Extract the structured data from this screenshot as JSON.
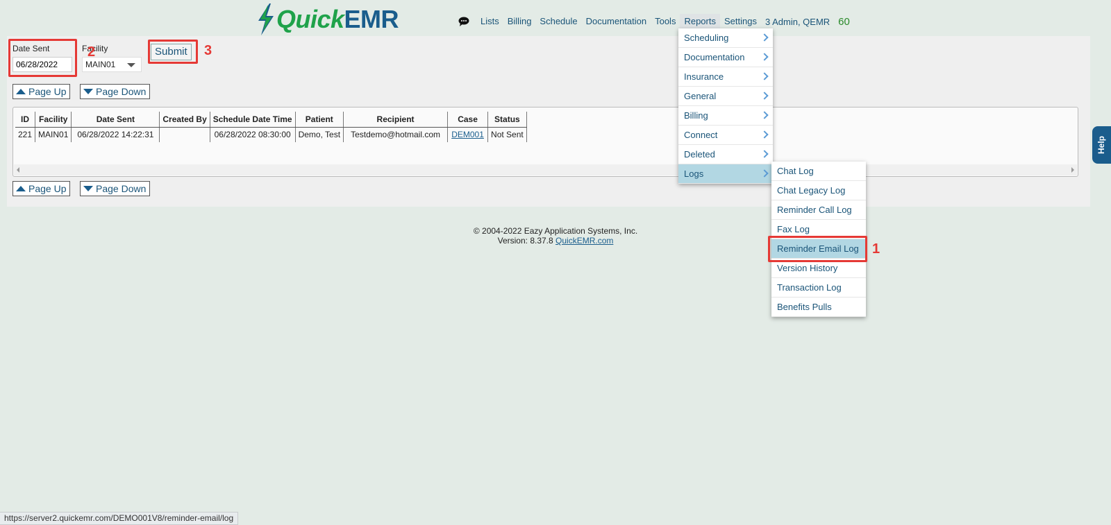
{
  "header": {
    "brand_part1": "Quick",
    "brand_part2": "EMR",
    "nav": [
      "Lists",
      "Billing",
      "Schedule",
      "Documentation",
      "Tools",
      "Reports",
      "Settings"
    ],
    "user": "3 Admin, QEMR",
    "count": "60"
  },
  "filters": {
    "date_label": "Date Sent",
    "date_value": "06/28/2022",
    "facility_label": "Facility",
    "facility_value": "MAIN01",
    "submit_label": "Submit"
  },
  "paging": {
    "up_label": "Page Up",
    "down_label": "Page Down"
  },
  "table": {
    "columns": [
      "ID",
      "Facility",
      "Date Sent",
      "Created By",
      "Schedule Date Time",
      "Patient",
      "Recipient",
      "Case",
      "Status"
    ],
    "rows": [
      [
        "221",
        "MAIN01",
        "06/28/2022 14:22:31",
        "",
        "06/28/2022 08:30:00",
        "Demo, Test",
        "Testdemo@hotmail.com",
        "DEM001",
        "Not Sent"
      ]
    ]
  },
  "reports_menu": [
    "Scheduling",
    "Documentation",
    "Insurance",
    "General",
    "Billing",
    "Connect",
    "Deleted",
    "Logs"
  ],
  "logs_submenu": [
    "Chat Log",
    "Chat Legacy Log",
    "Reminder Call Log",
    "Fax Log",
    "Reminder Email Log",
    "Version History",
    "Transaction Log",
    "Benefits Pulls"
  ],
  "help_label": "Help",
  "footer": {
    "copyright": "© 2004-2022 Eazy Application Systems, Inc.",
    "version_prefix": "Version: 8.37.8",
    "link": "QuickEMR.com"
  },
  "annotations": [
    "1",
    "2",
    "3"
  ],
  "status_url": "https://server2.quickemr.com/DEMO001V8/reminder-email/log",
  "colors": {
    "brand_green": "#1fa24a",
    "brand_blue": "#1a5d8c",
    "annotation_red": "#e53935",
    "menu_highlight": "#b2d7e3"
  }
}
